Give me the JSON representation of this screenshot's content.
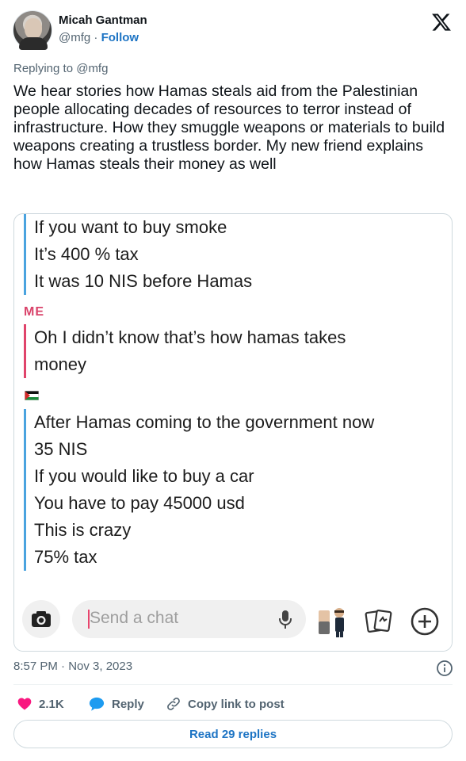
{
  "author": {
    "name": "Micah Gantman",
    "handle": "@mfg",
    "separator": "·",
    "follow_label": "Follow"
  },
  "replying_to": "Replying to @mfg",
  "tweet_text": "We hear stories how Hamas steals aid from the Palestinian people allocating decades of resources to terror instead of infrastructure. How they smuggle weapons or materials to build weapons creating a trustless border. My new friend explains how Hamas steals their money as well",
  "chat": {
    "block1": [
      "If you want to buy smoke",
      "It’s 400 % tax",
      "It was 10 NIS before Hamas"
    ],
    "me_label": "ME",
    "block2": [
      "Oh I didn’t know that’s how hamas takes",
      "money"
    ],
    "block3": [
      "After Hamas coming to the government now",
      "35 NIS",
      "If you would like to buy a car",
      "You have to pay 45000 usd",
      "This is crazy",
      "75% tax"
    ],
    "input_placeholder": "Send a chat",
    "friend_color": "#4aa3df",
    "me_color": "#e0446b"
  },
  "timestamp": "8:57 PM · Nov 3, 2023",
  "actions": {
    "likes": "2.1K",
    "reply_label": "Reply",
    "copy_label": "Copy link to post"
  },
  "read_replies_label": "Read 29 replies",
  "icons": [
    "x-logo-icon",
    "info-icon",
    "heart-icon",
    "reply-bubble-icon",
    "link-icon",
    "camera-icon",
    "microphone-icon",
    "bitmoji-icon",
    "cards-icon",
    "plus-icon",
    "palestine-flag-icon"
  ]
}
